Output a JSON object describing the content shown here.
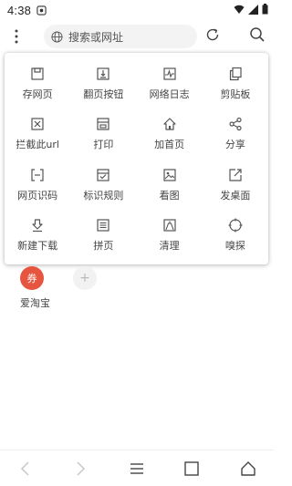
{
  "status_bar": {
    "time": "4:38"
  },
  "top_bar": {
    "search_placeholder": "搜索或网址"
  },
  "menu": {
    "items": [
      {
        "label": "存网页",
        "icon": "save-page-icon"
      },
      {
        "label": "翻页按钮",
        "icon": "page-turn-icon"
      },
      {
        "label": "网络日志",
        "icon": "network-log-icon"
      },
      {
        "label": "剪贴板",
        "icon": "clipboard-icon"
      },
      {
        "label": "拦截此url",
        "icon": "block-url-icon"
      },
      {
        "label": "打印",
        "icon": "print-icon"
      },
      {
        "label": "加首页",
        "icon": "add-home-icon"
      },
      {
        "label": "分享",
        "icon": "share-icon"
      },
      {
        "label": "网页识码",
        "icon": "scan-code-icon"
      },
      {
        "label": "标识规则",
        "icon": "mark-rule-icon"
      },
      {
        "label": "看图",
        "icon": "view-image-icon"
      },
      {
        "label": "发桌面",
        "icon": "send-desktop-icon"
      },
      {
        "label": "新建下载",
        "icon": "new-download-icon"
      },
      {
        "label": "拼页",
        "icon": "merge-page-icon"
      },
      {
        "label": "清理",
        "icon": "clean-icon"
      },
      {
        "label": "嗅探",
        "icon": "sniff-icon"
      }
    ]
  },
  "shortcuts": {
    "coupon_icon_text": "券",
    "coupon_label": "爱淘宝",
    "add_icon_text": "+"
  },
  "colors": {
    "accent": "#e5553f",
    "icon_gray": "#555555"
  }
}
